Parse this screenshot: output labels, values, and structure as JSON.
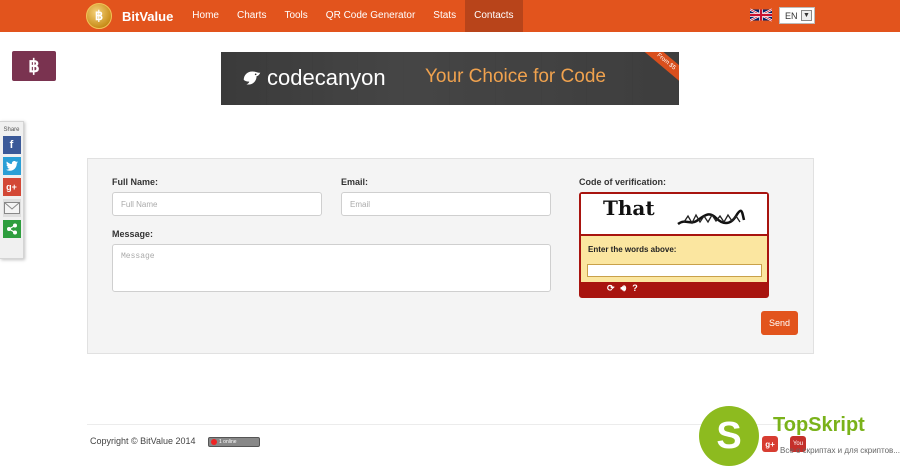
{
  "nav": {
    "brand": "BitValue",
    "items": [
      "Home",
      "Charts",
      "Tools",
      "QR Code Generator",
      "Stats",
      "Contacts"
    ],
    "active": "Contacts",
    "language": "EN"
  },
  "btc_button": {
    "icon": "bitcoin-icon",
    "glyph": "฿"
  },
  "share": {
    "label": "Share",
    "icons": [
      "facebook-icon",
      "twitter-icon",
      "google-plus-icon",
      "email-icon",
      "share-icon"
    ]
  },
  "banner": {
    "brand": "codecanyon",
    "tagline": "Your Choice for Code",
    "ribbon": "From $5"
  },
  "form": {
    "full_name_label": "Full Name:",
    "full_name_placeholder": "Full Name",
    "email_label": "Email:",
    "email_placeholder": "Email",
    "message_label": "Message:",
    "message_placeholder": "Message",
    "verification_label": "Code of verification:",
    "send_label": "Send"
  },
  "captcha": {
    "word": "That",
    "prompt": "Enter the words above:",
    "tools": [
      "refresh-icon",
      "audio-icon",
      "help-icon"
    ]
  },
  "footer": {
    "copyright": "Copyright © BitValue 2014",
    "online_text": "1 online"
  },
  "watermark": {
    "logo_letter": "S",
    "name": "TopSkript",
    "subtitle": "Все о скриптах и для скриптов...",
    "gplus": "g+",
    "youtube": "You"
  },
  "colors": {
    "nav_bg": "#e2541d",
    "nav_active": "#b8441a",
    "btc_bg": "#7a3350",
    "captcha_red": "#a8140f",
    "captcha_yellow": "#fbe6a0",
    "send_bg": "#e2541d"
  }
}
